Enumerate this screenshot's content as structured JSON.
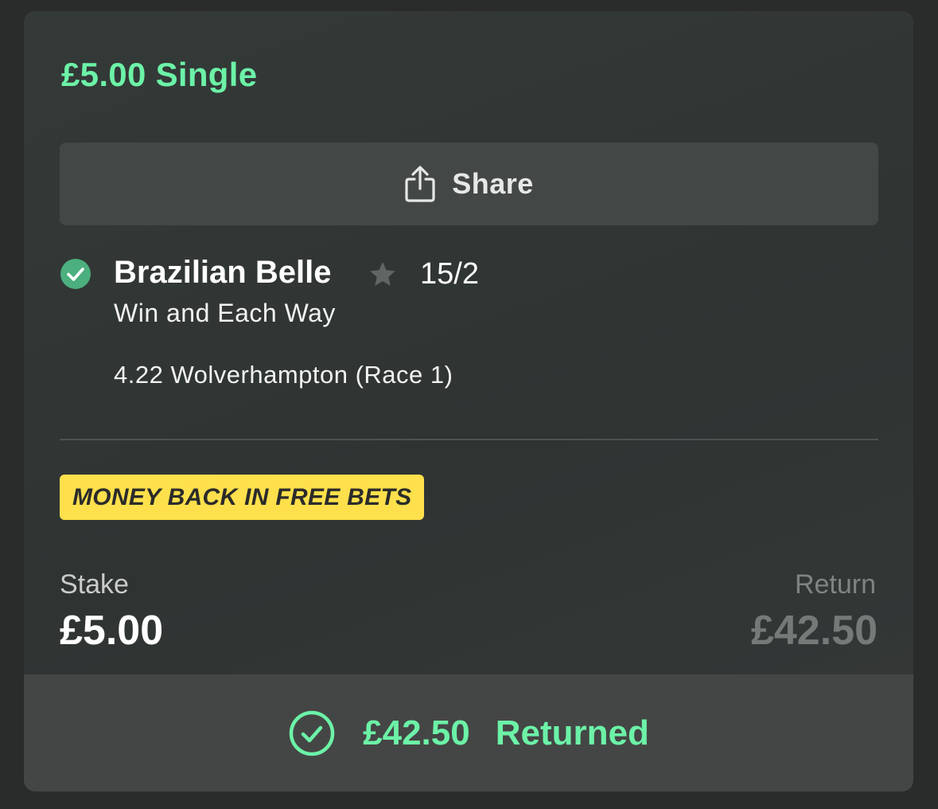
{
  "bet": {
    "title": "£5.00 Single",
    "share_label": "Share",
    "selection": {
      "name": "Brazilian Belle",
      "odds": "15/2",
      "market": "Win and Each Way",
      "event": "4.22 Wolverhampton (Race 1)",
      "status_icon": "check-circle-icon",
      "favourite_icon": "star-icon"
    },
    "promo_badge": "MONEY BACK IN FREE BETS",
    "stake_label": "Stake",
    "stake_value": "£5.00",
    "return_label": "Return",
    "return_value": "£42.50",
    "footer": {
      "amount": "£42.50",
      "status": "Returned",
      "icon": "check-circle-outline-icon"
    }
  },
  "colors": {
    "accent_green": "#6cf2a7",
    "check_green": "#4caf7e",
    "promo_yellow": "#fde04b",
    "card_background": "#323736",
    "footer_background": "#444645"
  }
}
